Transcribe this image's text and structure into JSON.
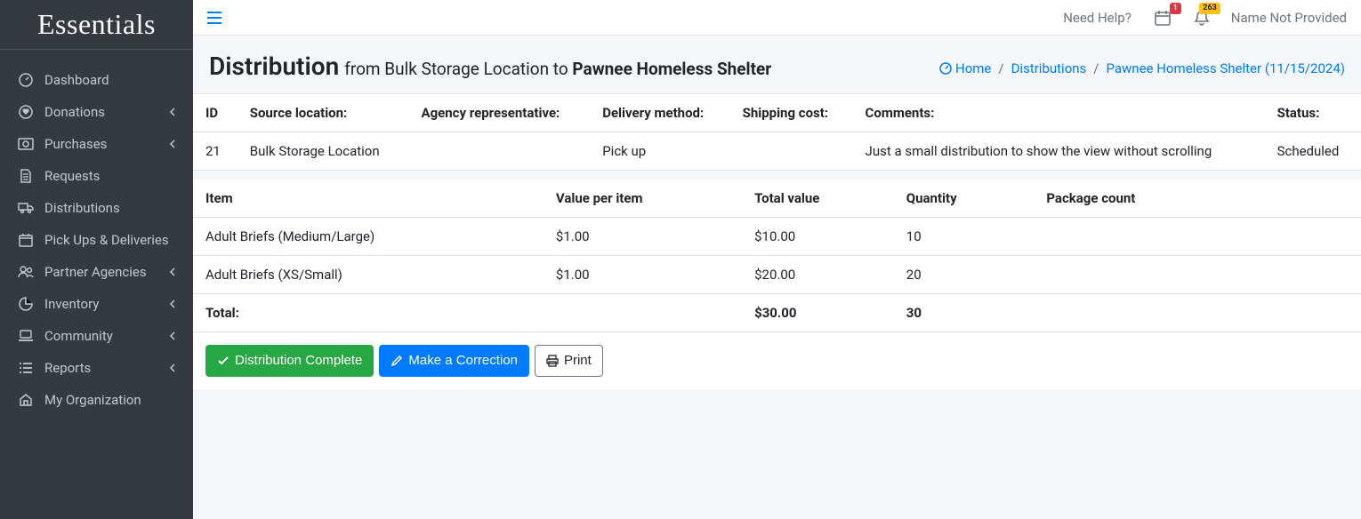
{
  "brand": "Essentials",
  "sidebar": {
    "items": [
      {
        "label": "Dashboard",
        "icon": "dashboard",
        "expandable": false
      },
      {
        "label": "Donations",
        "icon": "heart",
        "expandable": true
      },
      {
        "label": "Purchases",
        "icon": "money",
        "expandable": true
      },
      {
        "label": "Requests",
        "icon": "file",
        "expandable": false
      },
      {
        "label": "Distributions",
        "icon": "truck",
        "expandable": false
      },
      {
        "label": "Pick Ups & Deliveries",
        "icon": "calendar",
        "expandable": false
      },
      {
        "label": "Partner Agencies",
        "icon": "users",
        "expandable": true
      },
      {
        "label": "Inventory",
        "icon": "pie",
        "expandable": true
      },
      {
        "label": "Community",
        "icon": "laptop",
        "expandable": true
      },
      {
        "label": "Reports",
        "icon": "list",
        "expandable": true
      },
      {
        "label": "My Organization",
        "icon": "home",
        "expandable": false
      }
    ]
  },
  "topbar": {
    "help": "Need Help?",
    "calendar_badge": "1",
    "bell_badge": "263",
    "user": "Name Not Provided"
  },
  "header": {
    "title": "Distribution",
    "subtitle_prefix": "from Bulk Storage Location to ",
    "subtitle_strong": "Pawnee Homeless Shelter"
  },
  "breadcrumb": {
    "home": "Home",
    "mid": "Distributions",
    "leaf": "Pawnee Homeless Shelter (11/15/2024)"
  },
  "info_table": {
    "headers": {
      "id": "ID",
      "source": "Source location:",
      "agency": "Agency representative:",
      "delivery": "Delivery method:",
      "shipping": "Shipping cost:",
      "comments": "Comments:",
      "status": "Status:"
    },
    "row": {
      "id": "21",
      "source": "Bulk Storage Location",
      "agency": "",
      "delivery": "Pick up",
      "shipping": "",
      "comments": "Just a small distribution to show the view without scrolling",
      "status": "Scheduled"
    }
  },
  "items_table": {
    "headers": {
      "item": "Item",
      "vpi": "Value per item",
      "total_value": "Total value",
      "quantity": "Quantity",
      "package": "Package count"
    },
    "rows": [
      {
        "item": "Adult Briefs (Medium/Large)",
        "vpi": "$1.00",
        "total_value": "$10.00",
        "quantity": "10",
        "package": ""
      },
      {
        "item": "Adult Briefs (XS/Small)",
        "vpi": "$1.00",
        "total_value": "$20.00",
        "quantity": "20",
        "package": ""
      }
    ],
    "total": {
      "label": "Total:",
      "total_value": "$30.00",
      "quantity": "30"
    }
  },
  "actions": {
    "complete": "Distribution Complete",
    "correct": "Make a Correction",
    "print": "Print"
  }
}
